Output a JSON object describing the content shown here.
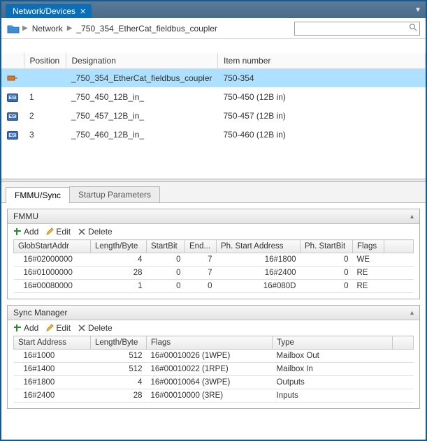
{
  "tab": {
    "title": "Network/Devices"
  },
  "breadcrumb": {
    "root": "Network",
    "current": "_750_354_EtherCat_fieldbus_coupler"
  },
  "search": {
    "placeholder": ""
  },
  "device_table": {
    "headers": {
      "position": "Position",
      "designation": "Designation",
      "item": "Item number"
    },
    "rows": [
      {
        "selected": true,
        "icon": "status",
        "position": "",
        "designation": "_750_354_EtherCat_fieldbus_coupler",
        "item": "750-354"
      },
      {
        "selected": false,
        "icon": "esi",
        "position": "1",
        "designation": "_750_450_12B_in_",
        "item": "750-450 (12B in)"
      },
      {
        "selected": false,
        "icon": "esi",
        "position": "2",
        "designation": "_750_457_12B_in_",
        "item": "750-457 (12B in)"
      },
      {
        "selected": false,
        "icon": "esi",
        "position": "3",
        "designation": "_750_460_12B_in_",
        "item": "750-460 (12B in)"
      }
    ]
  },
  "subtabs": {
    "a": "FMMU/Sync",
    "b": "Startup Parameters"
  },
  "toolbar": {
    "add": "Add",
    "edit": "Edit",
    "delete": "Delete"
  },
  "fmmu": {
    "title": "FMMU",
    "headers": {
      "addr": "GlobStartAddr",
      "len": "Length/Byte",
      "sb": "StartBit",
      "eb": "End...",
      "ph": "Ph. Start Address",
      "psb": "Ph. StartBit",
      "flags": "Flags"
    },
    "rows": [
      {
        "addr": "16#02000000",
        "len": "4",
        "sb": "0",
        "eb": "7",
        "ph": "16#1800",
        "psb": "0",
        "flags": "WE"
      },
      {
        "addr": "16#01000000",
        "len": "28",
        "sb": "0",
        "eb": "7",
        "ph": "16#2400",
        "psb": "0",
        "flags": "RE"
      },
      {
        "addr": "16#00080000",
        "len": "1",
        "sb": "0",
        "eb": "0",
        "ph": "16#080D",
        "psb": "0",
        "flags": "RE"
      }
    ]
  },
  "sync": {
    "title": "Sync Manager",
    "headers": {
      "addr": "Start Address",
      "len": "Length/Byte",
      "flags": "Flags",
      "type": "Type"
    },
    "rows": [
      {
        "addr": "16#1000",
        "len": "512",
        "flags": "16#00010026 (1WPE)",
        "type": "Mailbox Out"
      },
      {
        "addr": "16#1400",
        "len": "512",
        "flags": "16#00010022 (1RPE)",
        "type": "Mailbox In"
      },
      {
        "addr": "16#1800",
        "len": "4",
        "flags": "16#00010064 (3WPE)",
        "type": "Outputs"
      },
      {
        "addr": "16#2400",
        "len": "28",
        "flags": "16#00010000 (3RE)",
        "type": "Inputs"
      }
    ]
  }
}
